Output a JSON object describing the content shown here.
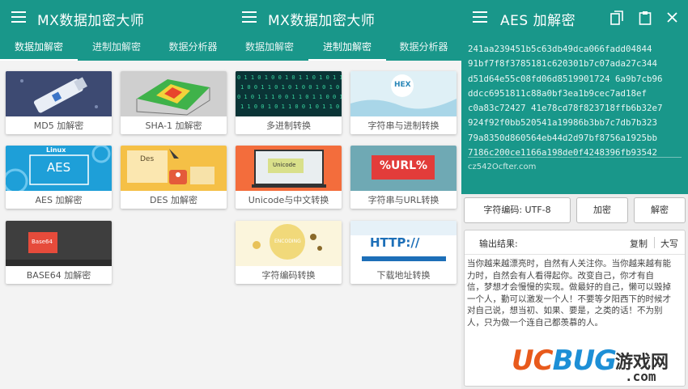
{
  "app_title": "MX数据加密大师",
  "tabs": [
    "数据加解密",
    "进制加解密",
    "数据分析器"
  ],
  "panel1": {
    "cards": [
      {
        "label": "MD5 加解密",
        "art": "usb-drive"
      },
      {
        "label": "SHA-1 加解密",
        "art": "surface-plot"
      },
      {
        "label": "AES 加解密",
        "art_text": "AES",
        "art_badge": "Linux"
      },
      {
        "label": "DES 加解密",
        "art_text": "Des"
      },
      {
        "label": "BASE64 加解密",
        "art_text": "Base64"
      }
    ]
  },
  "panel2": {
    "cards": [
      {
        "label": "多进制转换",
        "art": "binary-rain"
      },
      {
        "label": "字符串与进制转换",
        "art_text": "HEX"
      },
      {
        "label": "Unicode与中文转换",
        "art_text": "Unicode"
      },
      {
        "label": "字符串与URL转换",
        "art_text": "%URL%"
      },
      {
        "label": "字符编码转换",
        "art_text": "ENCODING"
      },
      {
        "label": "下载地址转换",
        "art_text": "HTTP://"
      }
    ]
  },
  "panel3": {
    "title": "AES 加解密",
    "cipher_lines": [
      "241aa239451b5c63db49dca066fadd04844",
      "91bf7f8f3785181c620301b7c07ada27c344",
      "d51d64e55c08fd06d8519901724 6a9b7cb96",
      "ddcc6951811c88a0bf3ea1b9cec7ad18ef",
      "c0a83c72427 41e78cd78f823718ffb6b32e7",
      "924f92f0bb520541a19986b3bb7c7db7b323",
      "79a8350d860564eb44d2d97bf8756a1925bb",
      "7186c200ce1166a198de0f4248396fb93542"
    ],
    "key": "cz542Ocfter.com",
    "encoding_button": "字符编码: UTF-8",
    "encrypt_button": "加密",
    "decrypt_button": "解密",
    "output_label": "输出结果:",
    "copy_label": "复制",
    "upper_label": "大写",
    "output_lines": [
      "当你越来越漂亮时，自然有人关注你。当你越来越有能",
      "力时，自然会有人看得起你。改变自己，你才有自",
      "信，梦想才会慢慢的实现。做最好的自己，懒可以毁掉",
      "一个人，勤可以激发一个人！不要等夕阳西下的时候才",
      "对自己说，想当初、如果、要是，之类的话！不为别",
      "人，只为做一个连自己都羡慕的人。"
    ]
  },
  "watermark": {
    "brand_uc": "UC",
    "brand_bug": "BUG",
    "site": "游戏网",
    "tld": ".com"
  },
  "colors": {
    "primary": "#19978a",
    "card_bg": "#ffffff",
    "accent_orange": "#e85a1c",
    "accent_blue": "#1d8fd6"
  }
}
